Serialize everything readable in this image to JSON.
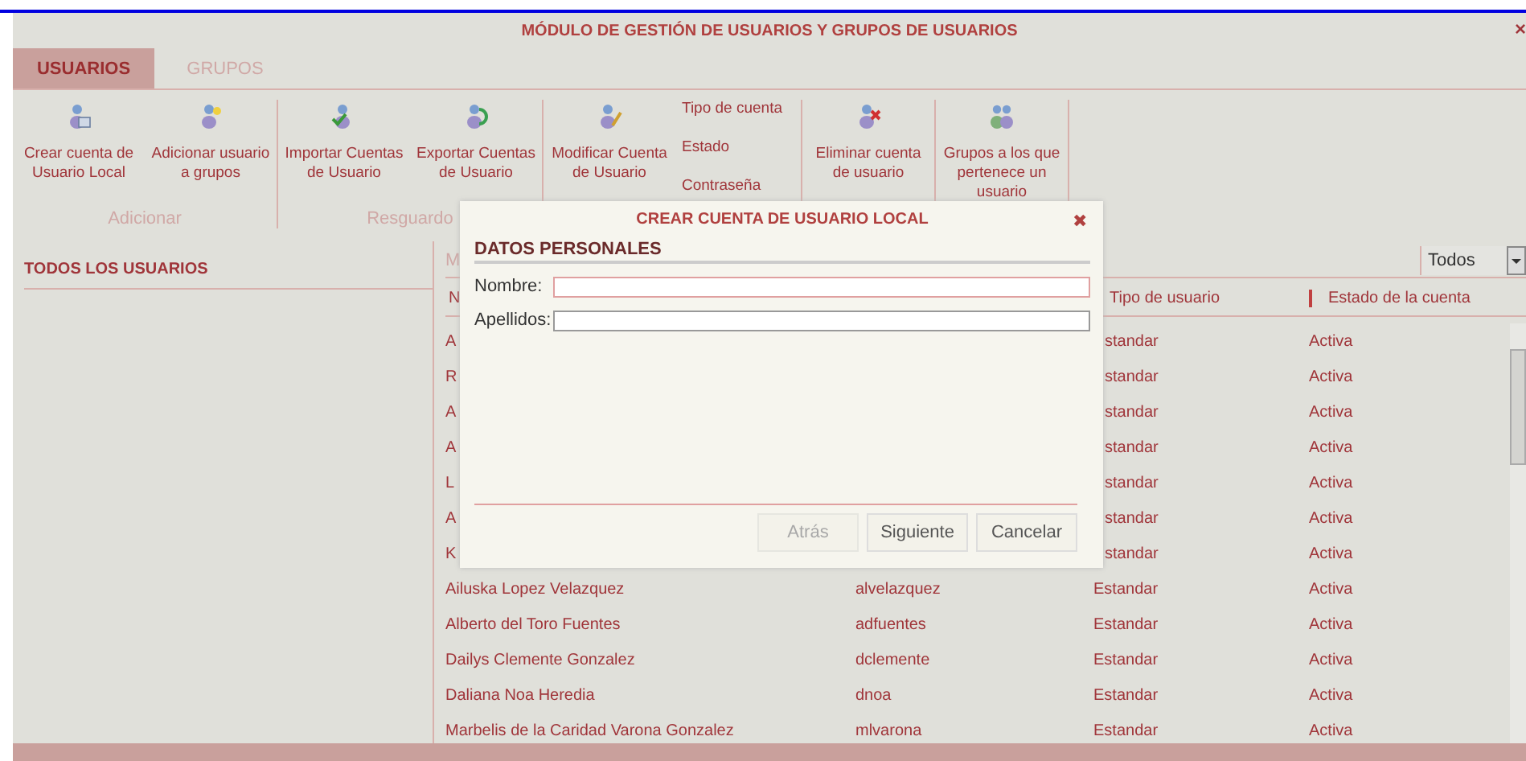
{
  "window": {
    "title": "MÓDULO DE GESTIÓN DE USUARIOS Y GRUPOS DE USUARIOS",
    "close": "×"
  },
  "tabs": [
    {
      "label": "USUARIOS",
      "selected": true
    },
    {
      "label": "GRUPOS",
      "selected": false
    }
  ],
  "toolbar": [
    {
      "label": "Adicionar",
      "items": [
        {
          "kind": "button",
          "label": "Crear cuenta de Usuario Local"
        },
        {
          "kind": "button",
          "label": "Adicionar usuario a grupos"
        }
      ]
    },
    {
      "label": "Resguardo",
      "items": [
        {
          "kind": "button",
          "label": "Importar Cuentas de Usuario"
        },
        {
          "kind": "button",
          "label": "Exportar Cuentas de Usuario"
        }
      ]
    },
    {
      "items": [
        {
          "kind": "button",
          "label": "Modificar Cuenta de Usuario"
        },
        {
          "kind": "list",
          "options": [
            "Tipo de cuenta",
            "Estado",
            "Contraseña"
          ]
        }
      ]
    },
    {
      "items": [
        {
          "kind": "button",
          "label": "Eliminar cuenta de usuario"
        }
      ]
    },
    {
      "items": [
        {
          "kind": "button",
          "label": "Grupos a los que pertenece un usuario"
        }
      ]
    }
  ],
  "sidebar": {
    "title": "TODOS LOS USUARIOS"
  },
  "filter": {
    "label": "M",
    "select": "Todos"
  },
  "table": {
    "columns": [
      "N",
      "Tipo de usuario",
      "Estado de la cuenta"
    ],
    "rows": [
      {
        "name": "A",
        "type": "standar",
        "status": "Activa"
      },
      {
        "name": "R",
        "type": "standar",
        "status": "Activa"
      },
      {
        "name": "A",
        "type": "standar",
        "status": "Activa"
      },
      {
        "name": "A",
        "type": "standar",
        "status": "Activa"
      },
      {
        "name": "L",
        "type": "standar",
        "status": "Activa"
      },
      {
        "name": "A",
        "type": "standar",
        "status": "Activa"
      },
      {
        "name": "K",
        "type": "standar",
        "status": "Activa"
      },
      {
        "name": "Ailuska Lopez Velazquez",
        "login": "alvelazquez",
        "type": "Estandar",
        "status": "Activa"
      },
      {
        "name": "Alberto del Toro Fuentes",
        "login": "adfuentes",
        "type": "Estandar",
        "status": "Activa"
      },
      {
        "name": "Dailys Clemente Gonzalez",
        "login": "dclemente",
        "type": "Estandar",
        "status": "Activa"
      },
      {
        "name": "Daliana Noa Heredia",
        "login": "dnoa",
        "type": "Estandar",
        "status": "Activa"
      },
      {
        "name": "Marbelis de la Caridad Varona Gonzalez",
        "login": "mlvarona",
        "type": "Estandar",
        "status": "Activa"
      }
    ]
  },
  "dialog": {
    "title": "CREAR CUENTA DE USUARIO LOCAL",
    "close": "✖",
    "section": "DATOS PERSONALES",
    "fields": [
      {
        "label": "Nombre:",
        "focused": true
      },
      {
        "label": "Apellidos:",
        "focused": false
      }
    ],
    "buttons": [
      {
        "label": "Atrás",
        "disabled": true
      },
      {
        "label": "Siguiente",
        "disabled": false
      },
      {
        "label": "Cancelar",
        "disabled": false
      }
    ]
  }
}
